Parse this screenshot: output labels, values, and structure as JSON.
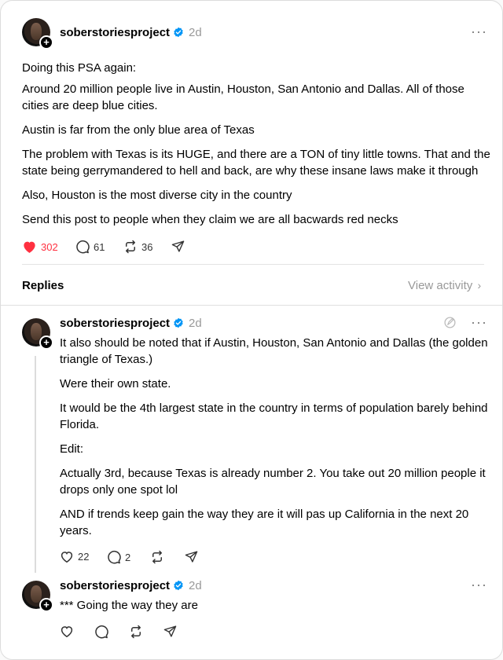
{
  "post": {
    "username": "soberstoriesproject",
    "time": "2d",
    "paragraphs": [
      "Doing this PSA again:",
      "Around 20 million people live in Austin, Houston, San Antonio and Dallas. All of those cities are deep blue cities.",
      "Austin is far from the only blue area of Texas",
      "The problem with Texas is its HUGE, and there are a TON of tiny little towns. That and the state being gerrymandered to hell and back, are why these insane laws make it through",
      "Also, Houston is the most diverse city in the country",
      "Send this post to people when they claim we are all bacwards red necks"
    ],
    "likes": "302",
    "comments": "61",
    "reposts": "36"
  },
  "replies_header": {
    "title": "Replies",
    "view_activity": "View activity"
  },
  "reply1": {
    "username": "soberstoriesproject",
    "time": "2d",
    "paragraphs": [
      "It also should be noted that if Austin, Houston, San Antonio and Dallas (the golden triangle of Texas.)",
      "Were their own state.",
      "It would be the 4th largest state in the country in terms of population barely behind Florida.",
      "Edit:",
      "Actually 3rd, because Texas is already number 2. You take out 20 million people it drops only one spot lol",
      "AND if trends keep gain the way they are it will pas up California in the next 20 years."
    ],
    "likes": "22",
    "comments": "2"
  },
  "reply2": {
    "username": "soberstoriesproject",
    "time": "2d",
    "text": "*** Going the way they are"
  },
  "colors": {
    "like_red": "#ff3040",
    "verified_blue": "#0095f6",
    "muted": "#999999"
  }
}
